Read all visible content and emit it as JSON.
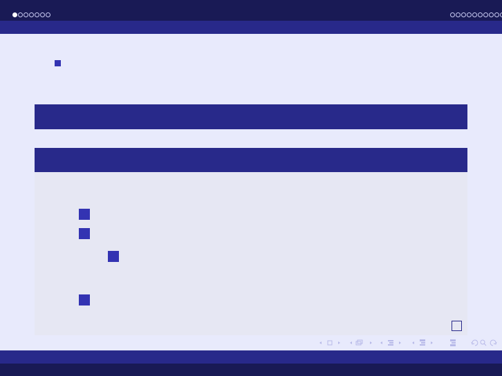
{
  "header": {
    "section_dots": [
      true,
      false,
      false,
      false,
      false,
      false,
      false
    ],
    "subsection_dots": [
      false,
      false,
      false,
      false,
      false,
      false,
      false,
      false,
      false,
      false
    ]
  },
  "navigation": {
    "icons": [
      "nav-slide-icon",
      "nav-frame-icon",
      "nav-subsection-icon",
      "nav-section-icon",
      "nav-document-icon",
      "nav-search-icon"
    ]
  },
  "colors": {
    "header_dark": "#191a55",
    "header_bar": "#28298a",
    "bullet": "#3333b2",
    "background": "#e8eafc",
    "block_body": "#e6e7f3"
  }
}
